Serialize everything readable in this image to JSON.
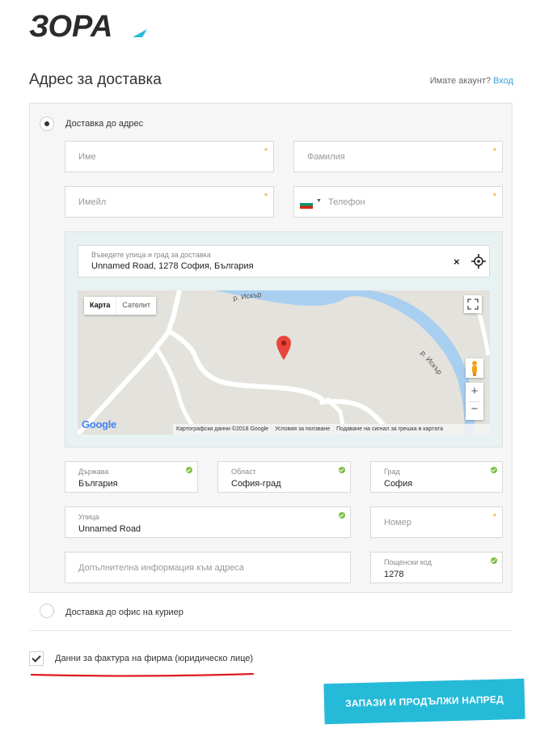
{
  "brand": {
    "logo_text": "ЗОРА"
  },
  "page": {
    "title": "Адрес за доставка"
  },
  "account": {
    "prompt": "Имате акаунт?",
    "login": "Вход"
  },
  "delivery": {
    "to_address": "Доставка до адрес",
    "to_office": "Доставка до офис на куриер"
  },
  "form": {
    "first_name": {
      "placeholder": "Име"
    },
    "last_name": {
      "placeholder": "Фамилия"
    },
    "email": {
      "placeholder": "Имейл"
    },
    "phone": {
      "placeholder": "Телефон"
    },
    "country": {
      "label": "Държава",
      "value": "България"
    },
    "region": {
      "label": "Област",
      "value": "София-град"
    },
    "city": {
      "label": "Град",
      "value": "София"
    },
    "street": {
      "label": "Улица",
      "value": "Unnamed Road"
    },
    "number": {
      "placeholder": "Номер"
    },
    "extra": {
      "placeholder": "Допълнителна информация към адреса"
    },
    "postcode": {
      "label": "Пощенски код",
      "value": "1278"
    }
  },
  "address_search": {
    "label": "Въведете улица и град за доставка",
    "value": "Unnamed Road, 1278 София, България"
  },
  "map": {
    "tab_map": "Карта",
    "tab_satellite": "Сателит",
    "river_label_1": "р. Искър",
    "river_label_2": "р. Искър",
    "zoom_in": "+",
    "zoom_out": "−",
    "google": "Google",
    "attribution": "Картографски данни ©2018 Google",
    "terms": "Условия за ползване",
    "report": "Подаване на сигнал за грешка в картата"
  },
  "invoice": {
    "label": "Данни за фактура на фирма (юридическо лице)"
  },
  "submit": {
    "label": "ЗАПАЗИ И ПРОДЪЛЖИ НАПРЕД"
  },
  "colors": {
    "accent": "#25bad8",
    "valid": "#7cbf3e",
    "required": "#f39c1f",
    "underline": "#e11b22"
  }
}
